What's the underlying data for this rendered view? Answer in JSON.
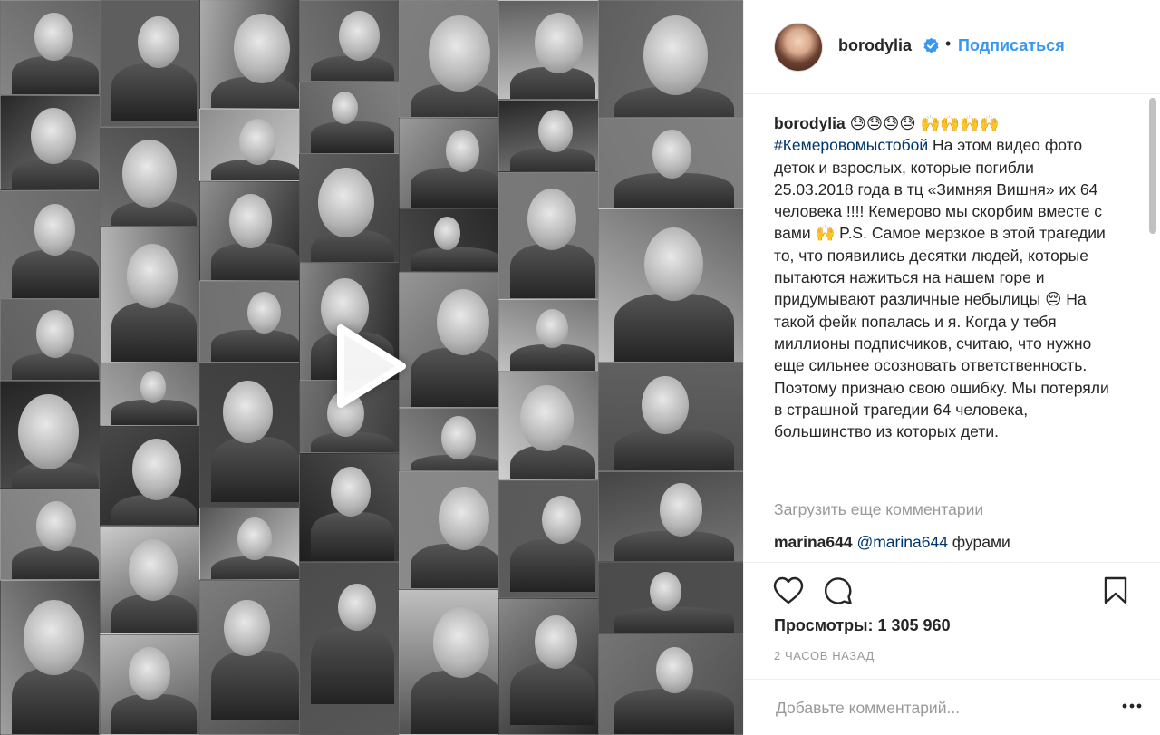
{
  "media": {
    "play_icon": "play-icon"
  },
  "header": {
    "username": "borodylia",
    "verified_icon": "verified-badge-icon",
    "separator": "•",
    "follow_label": "Подписаться"
  },
  "caption": {
    "username": "borodylia",
    "emojis": "😓😓😓😓 🙌🙌🙌🙌",
    "hashtag": "#Кемеровомыстобой",
    "text": " На этом видео фото деток и взрослых, которые погибли 25.03.2018 года в тц «Зимняя Вишня» их 64 человека !!!! Кемерово мы скорбим вместе с вами 🙌 P.S. Самое мерзкое в этой трагедии то, что появились десятки людей, которые пытаются нажиться на нашем горе и придумывают различные небылицы 😔 На такой фейк попалась и я. Когда у тебя миллионы подписчиков, считаю, что нужно еще сильнее осозновать ответственность. Поэтому признаю свою ошибку. Мы потеряли в страшной трагедии 64 человека, большинство из которых дети."
  },
  "load_more": "Загрузить еще комментарии",
  "comment": {
    "username": "marina644",
    "mention": "@marina644",
    "text": " фурами"
  },
  "actions": {
    "like_icon": "heart-icon",
    "comment_icon": "comment-icon",
    "save_icon": "bookmark-icon"
  },
  "views": "Просмотры: 1 305 960",
  "timestamp": "2 ЧАСОВ НАЗАД",
  "add_comment": {
    "placeholder": "Добавьте комментарий...",
    "more_icon": "more-options-icon"
  }
}
